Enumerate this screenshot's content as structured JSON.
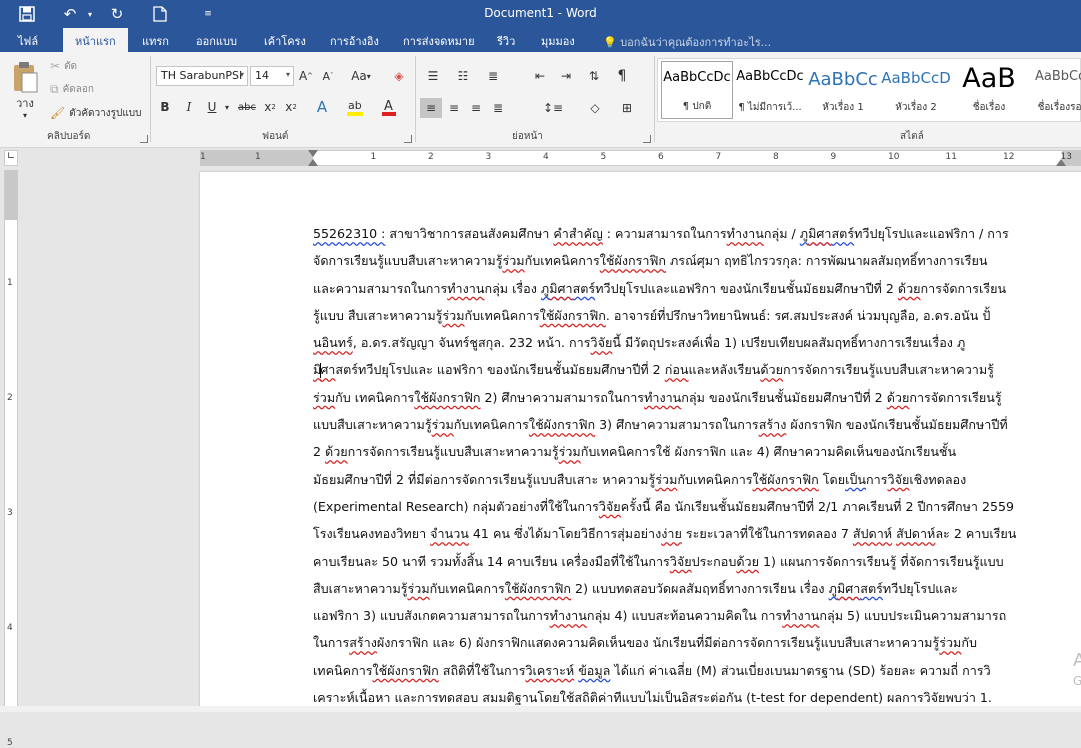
{
  "window": {
    "title": "Document1 - Word"
  },
  "quick_access": {
    "save_icon": "save-icon",
    "undo_icon": "undo-icon",
    "redo_icon": "redo-icon",
    "new_icon": "new-doc-icon",
    "customize_icon": "customize-icon"
  },
  "tabs": [
    {
      "label": "ไฟล์"
    },
    {
      "label": "หน้าแรก",
      "active": true
    },
    {
      "label": "แทรก"
    },
    {
      "label": "ออกแบบ"
    },
    {
      "label": "เค้าโครง"
    },
    {
      "label": "การอ้างอิง"
    },
    {
      "label": "การส่งจดหมาย"
    },
    {
      "label": "รีวิว"
    },
    {
      "label": "มุมมอง"
    }
  ],
  "tell_me": {
    "placeholder": "บอกฉันว่าคุณต้องการทำอะไร..."
  },
  "clipboard": {
    "paste_label": "วาง",
    "cut_label": "ตัด",
    "copy_label": "คัดลอก",
    "format_painter_label": "ตัวคัดวางรูปแบบ",
    "group_label": "คลิปบอร์ด"
  },
  "font": {
    "family": "TH SarabunPSI",
    "size": "14",
    "group_label": "ฟอนต์",
    "grow": "A",
    "shrink": "A",
    "case": "Aa",
    "bold": "B",
    "italic": "I",
    "underline": "U",
    "strike": "abc",
    "subscript": "x",
    "superscript": "x"
  },
  "paragraph": {
    "group_label": "ย่อหน้า",
    "pilcrow": "¶"
  },
  "styles": {
    "group_label": "สไตล์",
    "items": [
      {
        "preview": "AaBbCcDc",
        "name": "¶ ปกติ",
        "color": "#000000",
        "size": "13px",
        "selected": true
      },
      {
        "preview": "AaBbCcDc",
        "name": "¶ ไม่มีการเว้...",
        "color": "#000000",
        "size": "13px"
      },
      {
        "preview": "AaBbCc",
        "name": "หัวเรื่อง 1",
        "color": "#2e74b5",
        "size": "18px"
      },
      {
        "preview": "AaBbCcD",
        "name": "หัวเรื่อง 2",
        "color": "#2e74b5",
        "size": "15px"
      },
      {
        "preview": "AaB",
        "name": "ชื่อเรื่อง",
        "color": "#000000",
        "size": "27px"
      },
      {
        "preview": "AaBbCcI",
        "name": "ชื่อเรื่องรอง",
        "color": "#595959",
        "size": "13px"
      }
    ]
  },
  "ruler": {
    "numbers": [
      "1",
      "1",
      "1",
      "2",
      "3",
      "4",
      "5",
      "6",
      "7",
      "8",
      "9",
      "10",
      "11",
      "12",
      "13"
    ]
  },
  "vruler": {
    "numbers": [
      "1",
      "2",
      "3",
      "4",
      "5"
    ]
  },
  "document": {
    "lines": [
      "55262310 : สาขาวิชาการสอนสังคมศึกษา คำสำคัญ : ความสามารถในการทำงานกลุ่ม / ภูมิศาสตร์ทวีปยุโรปและแอฟริกา / การ",
      "จัดการเรียนรู้แบบสืบเสาะหาความรู้ร่วมกับเทคนิคการใช้ผังกราฟิก ภรณ์ศุมา ฤทธิไกรวรกุล: การพัฒนาผลสัมฤทธิ์ทางการเรียน",
      "และความสามารถในการทำงานกลุ่ม เรื่อง ภูมิศาสตร์ทวีปยุโรปและแอฟริกา ของนักเรียนชั้นมัธยมศึกษาปีที่ 2 ด้วยการจัดการเรียน",
      "รู้แบบ สืบเสาะหาความรู้ร่วมกับเทคนิคการใช้ผังกราฟิก. อาจารย์ที่ปรึกษาวิทยานิพนธ์: รศ.สมประสงค์ น่วมบุญลือ, อ.ดร.อนัน ปั้",
      "นอินทร์, อ.ดร.สรัญญา จันทร์ชูสกุล. 232 หน้า. การวิจัยนี้ มีวัตถุประสงค์เพื่อ 1) เปรียบเทียบผลสัมฤทธิ์ทางการเรียนเรื่อง ภู",
      "มิศาสตร์ทวีปยุโรปและ แอฟริกา ของนักเรียนชั้นมัธยมศึกษาปีที่ 2 ก่อนและหลังเรียนด้วยการจัดการเรียนรู้แบบสืบเสาะหาความรู้",
      "ร่วมกับ เทคนิคการใช้ผังกราฟิก 2) ศึกษาความสามารถในการทำงานกลุ่ม ของนักเรียนชั้นมัธยมศึกษาปีที่ 2 ด้วยการจัดการเรียนรู้",
      "แบบสืบเสาะหาความรู้ร่วมกับเทคนิคการใช้ผังกราฟิก 3) ศึกษาความสามารถในการสร้าง ผังกราฟิก ของนักเรียนชั้นมัธยมศึกษาปีที่",
      "2 ด้วยการจัดการเรียนรู้แบบสืบเสาะหาความรู้ร่วมกับเทคนิคการใช้ ผังกราฟิก และ 4) ศึกษาความคิดเห็นของนักเรียนชั้น",
      "มัธยมศึกษาปีที่ 2 ที่มีต่อการจัดการเรียนรู้แบบสืบเสาะ หาความรู้ร่วมกับเทคนิคการใช้ผังกราฟิก โดยเป็นการวิจัยเชิงทดลอง",
      "(Experimental Research) กลุ่มตัวอย่างที่ใช้ในการวิจัยครั้งนี้ คือ นักเรียนชั้นมัธยมศึกษาปีที่ 2/1 ภาคเรียนที่ 2 ปีการศึกษา 2559",
      "โรงเรียนคงทองวิทยา จำนวน 41 คน ซึ่งได้มาโดยวิธีการสุ่มอย่างง่าย ระยะเวลาที่ใช้ในการทดลอง 7 สัปดาห์ สัปดาห์ละ 2 คาบเรียน",
      "คาบเรียนละ 50 นาที รวมทั้งสิ้น 14 คาบเรียน เครื่องมือที่ใช้ในการวิจัยประกอบด้วย 1) แผนการจัดการเรียนรู้ ที่จัดการเรียนรู้แบบ",
      "สืบเสาะหาความรู้ร่วมกับเทคนิคการใช้ผังกราฟิก 2) แบบทดสอบวัดผลสัมฤทธิ์ทางการเรียน เรื่อง ภูมิศาสตร์ทวีปยุโรปและ",
      "แอฟริกา 3) แบบสังเกตความสามารถในการทำงานกลุ่ม 4) แบบสะท้อนความคิดใน การทำงานกลุ่ม 5) แบบประเมินความสามารถ",
      "ในการสร้างผังกราฟิก และ 6) ผังกราฟิกแสดงความคิดเห็นของ นักเรียนที่มีต่อการจัดการเรียนรู้แบบสืบเสาะหาความรู้ร่วมกับ",
      "เทคนิคการใช้ผังกราฟิก สถิติที่ใช้ในการวิเคราะห์ ข้อมูล ได้แก่ ค่าเฉลี่ย (M) ส่วนเบี่ยงเบนมาตรฐาน (SD) ร้อยละ ความถี่ การวิ",
      "เคราะห์เนื้อหา และการทดสอบ สมมติฐานโดยใช้สถิติค่าทีแบบไม่เป็นอิสระต่อกัน (t-test for dependent) ผลการวิจัยพบว่า 1."
    ]
  },
  "colors": {
    "accent": "#2b579a",
    "ribbon_bg": "#f3f3f3",
    "canvas": "#e6e6e6"
  }
}
